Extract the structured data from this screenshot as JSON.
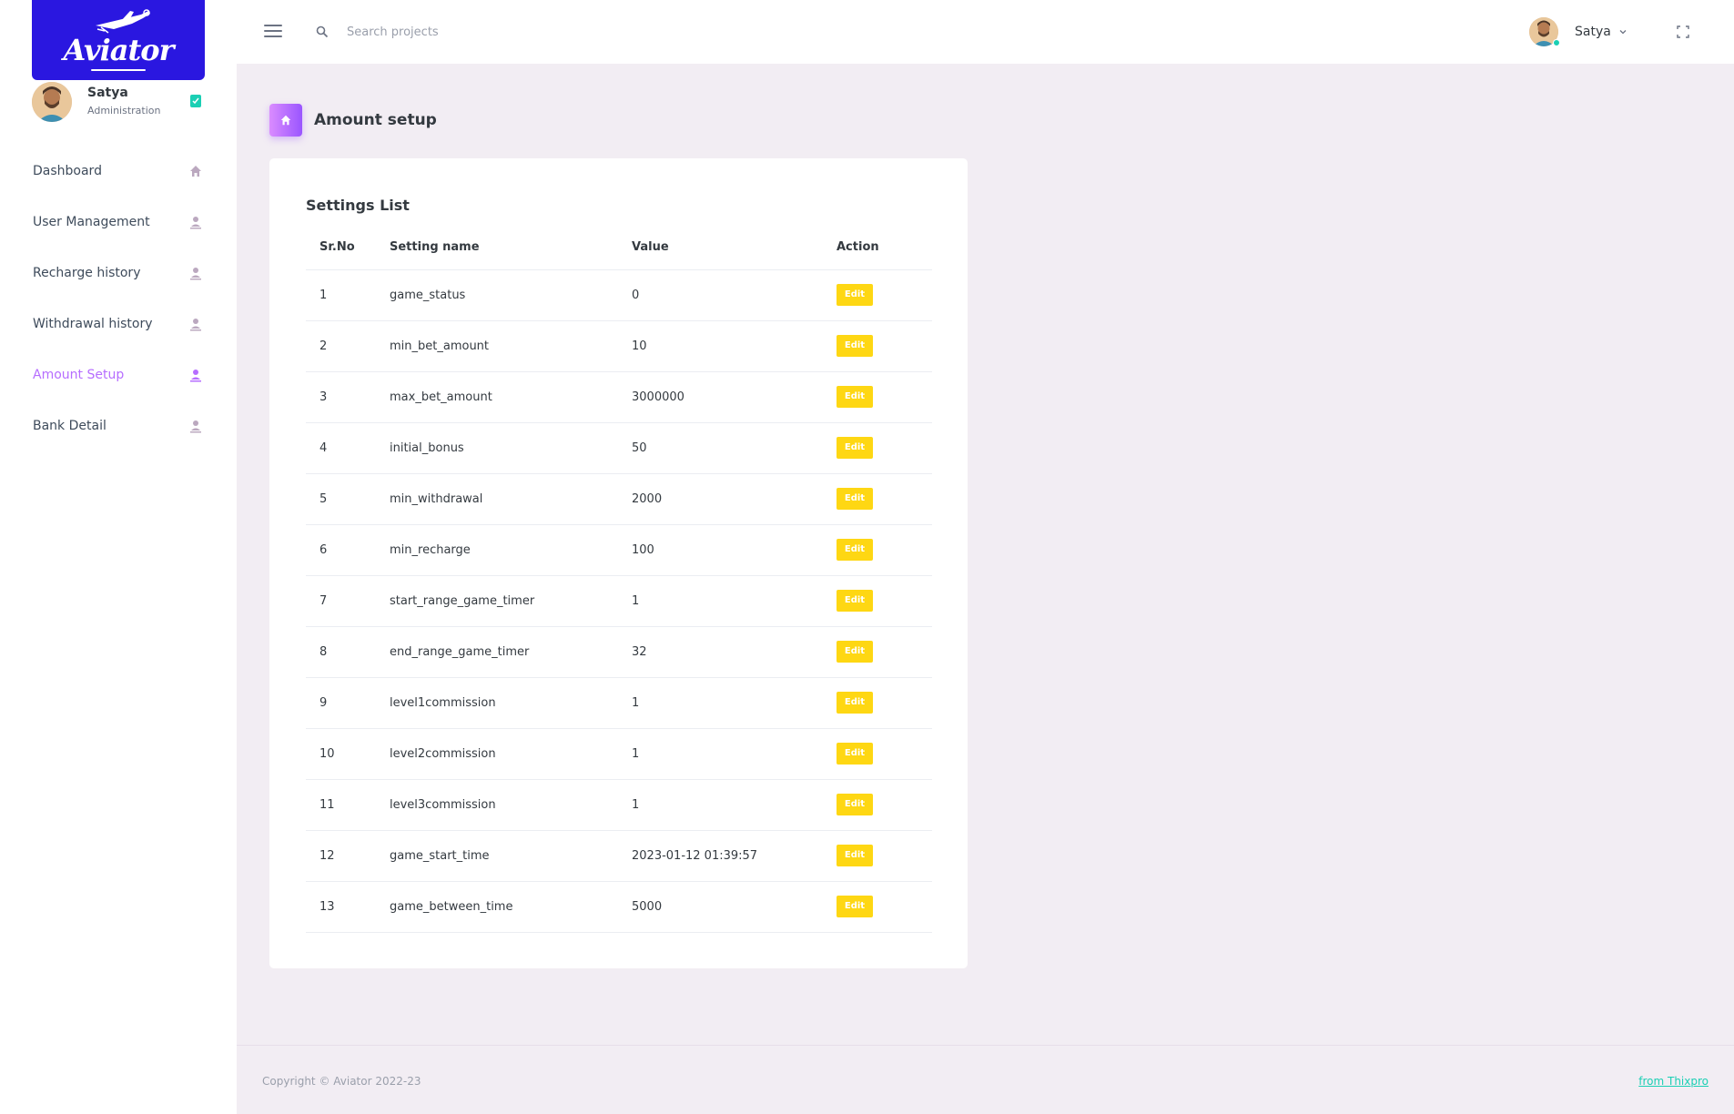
{
  "brand": {
    "name": "Aviator"
  },
  "profile": {
    "name": "Satya",
    "role": "Administration"
  },
  "sidebar": {
    "items": [
      {
        "label": "Dashboard",
        "icon": "home-icon"
      },
      {
        "label": "User Management",
        "icon": "user-icon"
      },
      {
        "label": "Recharge history",
        "icon": "user-icon"
      },
      {
        "label": "Withdrawal history",
        "icon": "user-icon"
      },
      {
        "label": "Amount Setup",
        "icon": "user-icon",
        "active": true
      },
      {
        "label": "Bank Detail",
        "icon": "user-icon"
      }
    ]
  },
  "topbar": {
    "search_placeholder": "Search projects",
    "username": "Satya"
  },
  "page": {
    "title": "Amount setup"
  },
  "card": {
    "title": "Settings List",
    "columns": [
      "Sr.No",
      "Setting name",
      "Value",
      "Action"
    ],
    "edit_label": "Edit",
    "rows": [
      [
        "1",
        "game_status",
        "0"
      ],
      [
        "2",
        "min_bet_amount",
        "10"
      ],
      [
        "3",
        "max_bet_amount",
        "3000000"
      ],
      [
        "4",
        "initial_bonus",
        "50"
      ],
      [
        "5",
        "min_withdrawal",
        "2000"
      ],
      [
        "6",
        "min_recharge",
        "100"
      ],
      [
        "7",
        "start_range_game_timer",
        "1"
      ],
      [
        "8",
        "end_range_game_timer",
        "32"
      ],
      [
        "9",
        "level1commission",
        "1"
      ],
      [
        "10",
        "level2commission",
        "1"
      ],
      [
        "11",
        "level3commission",
        "1"
      ],
      [
        "12",
        "game_start_time",
        "2023-01-12 01:39:57"
      ],
      [
        "13",
        "game_between_time",
        "5000"
      ]
    ]
  },
  "footer": {
    "copyright": "Copyright © Aviator 2022-23",
    "link": "from Thixpro"
  },
  "colors": {
    "brand": "#2a17e0",
    "accent": "#b66dff",
    "edit_button": "#fed713",
    "link": "#1bcfb4"
  }
}
